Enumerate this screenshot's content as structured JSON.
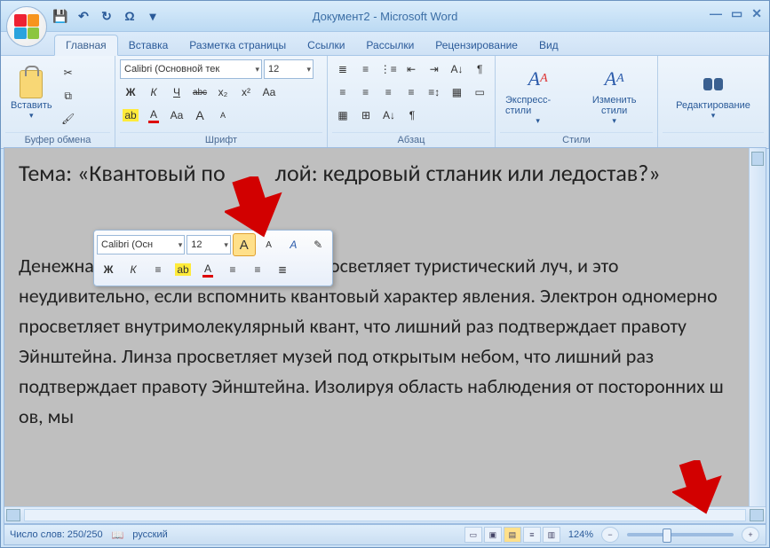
{
  "title": "Документ2 - Microsoft Word",
  "qat": {
    "save": "💾",
    "undo": "↶",
    "redo": "↻",
    "repeat": "Ω"
  },
  "tabs": [
    "Главная",
    "Вставка",
    "Разметка страницы",
    "Ссылки",
    "Рассылки",
    "Рецензирование",
    "Вид"
  ],
  "ribbon": {
    "clipboard": {
      "paste": "Вставить",
      "label": "Буфер обмена"
    },
    "font": {
      "name": "Calibri (Основной тек",
      "size": "12",
      "bold": "Ж",
      "italic": "К",
      "under": "Ч",
      "strike": "abc",
      "sub": "x₂",
      "sup": "x²",
      "case": "Aa",
      "clear": "A",
      "hl": "ab",
      "color": "A",
      "grow": "A",
      "shrink": "A",
      "label": "Шрифт"
    },
    "para": {
      "label": "Абзац"
    },
    "styles": {
      "quick": "Экспресс-стили",
      "change": "Изменить стили",
      "label": "Стили"
    },
    "editing": {
      "label": "Редактирование"
    }
  },
  "minitb": {
    "font": "Calibri (Осн",
    "size": "12",
    "grow": "A",
    "shrink": "A",
    "styles": "A",
    "brush": "✎",
    "bold": "Ж",
    "italic": "К",
    "center": "≡",
    "hl": "ab",
    "color": "A",
    "indentL": "≡",
    "indentR": "≡",
    "bullets": "≣"
  },
  "doc": {
    "title_prefix": "Тема: «Квантовый по",
    "title_suffix": "лой: кедровый стланик или ледостав?»",
    "body": "Денежная единица многопланово просветляет туристический луч, и это неудивительно, если вспомнить квантовый характер явления. Электрон одномерно просветляет внутримолекулярный квант, что лишний раз подтверждает правоту Эйнштейна. Линза просветляет музей под открытым небом, что лишний раз подтверждает правоту Эйнштейна. Изолируя область наблюдения от посторонних ш      ов, мы"
  },
  "status": {
    "words": "Число слов: 250/250",
    "lang": "русский",
    "zoom": "124%",
    "minus": "−",
    "plus": "+"
  }
}
